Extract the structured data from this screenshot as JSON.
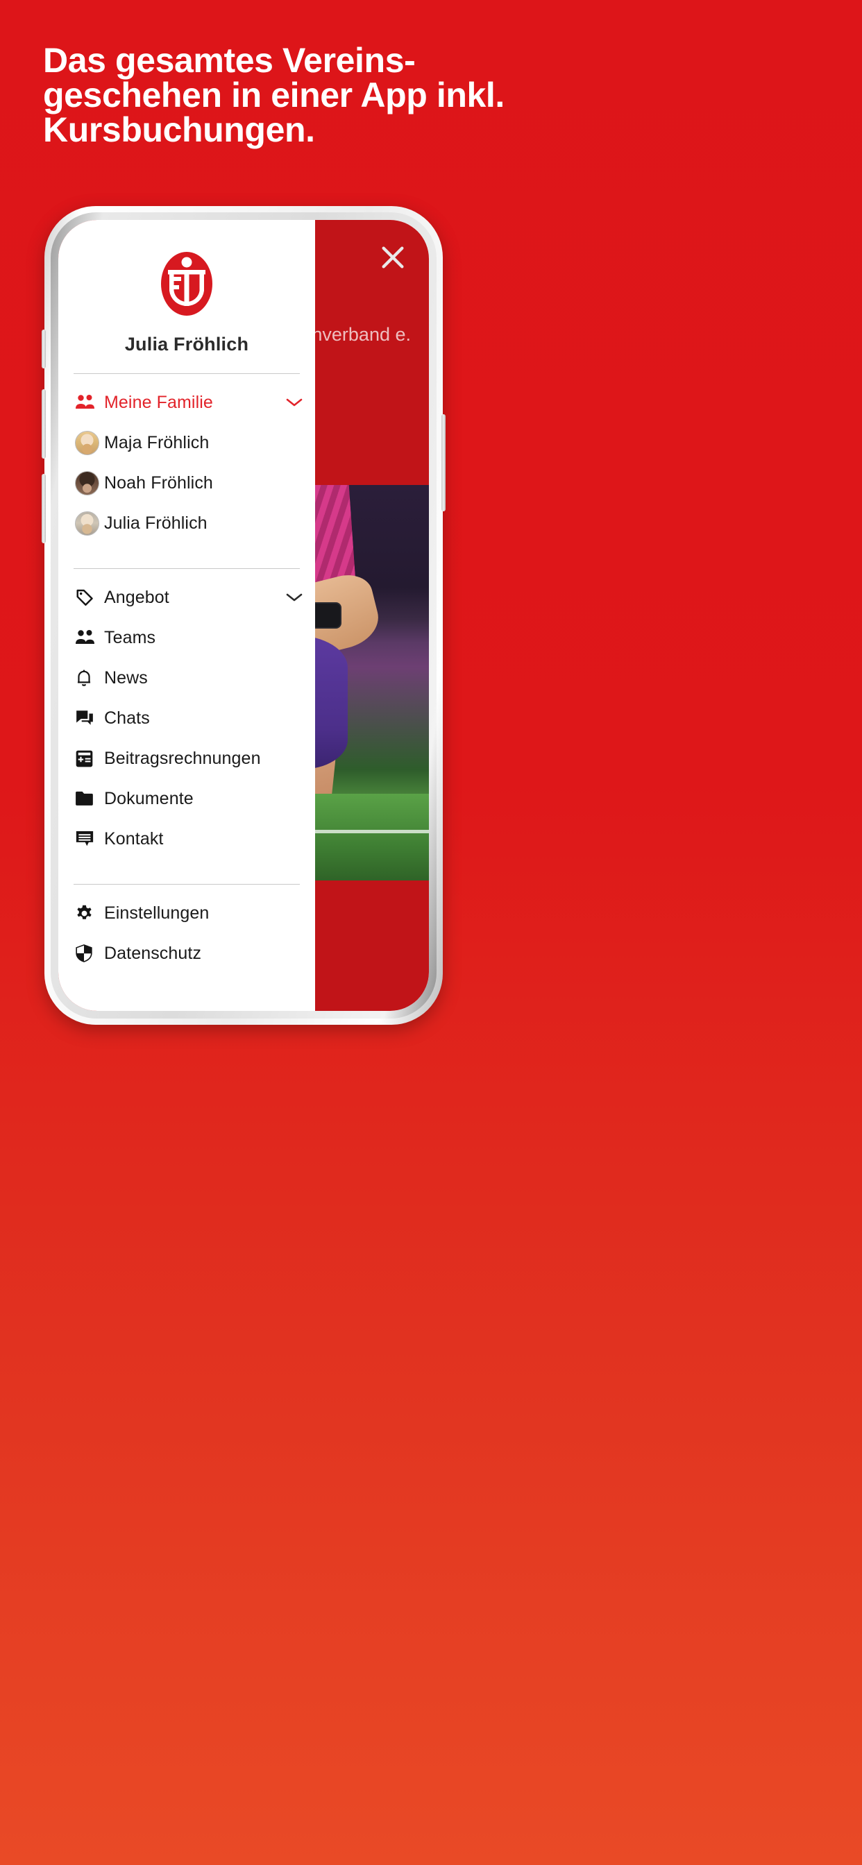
{
  "page": {
    "background_color": "#DD1519",
    "accent_color": "#E2232A"
  },
  "headline": {
    "line1": "Das gesamtes Vereins-",
    "line2": "geschehen in einer App inkl.",
    "line3": "Kursbuchungen."
  },
  "phone": {
    "app_background": {
      "association_text": "urnverband e.",
      "close_icon": "close-icon",
      "header_color": "#C11418"
    },
    "drawer": {
      "logo": "ftv-logo",
      "user_name": "Julia Fröhlich",
      "family_section": {
        "header": {
          "label": "Meine Familie",
          "icon": "group-icon",
          "chevron": "chevron-down-icon"
        },
        "members": [
          {
            "name": "Maja Fröhlich",
            "avatar": "avatar-maja"
          },
          {
            "name": "Noah Fröhlich",
            "avatar": "avatar-noah"
          },
          {
            "name": "Julia Fröhlich",
            "avatar": "avatar-julia"
          }
        ]
      },
      "main_menu": [
        {
          "label": "Angebot",
          "icon": "tag-icon",
          "chevron": "chevron-down-icon"
        },
        {
          "label": "Teams",
          "icon": "group-icon"
        },
        {
          "label": "News",
          "icon": "bell-icon"
        },
        {
          "label": "Chats",
          "icon": "chat-icon"
        },
        {
          "label": "Beitragsrechnungen",
          "icon": "invoice-icon"
        },
        {
          "label": "Dokumente",
          "icon": "folder-icon"
        },
        {
          "label": "Kontakt",
          "icon": "message-lines-icon"
        }
      ],
      "footer_menu": [
        {
          "label": "Einstellungen",
          "icon": "gear-icon"
        },
        {
          "label": "Datenschutz",
          "icon": "shield-icon"
        }
      ]
    }
  }
}
